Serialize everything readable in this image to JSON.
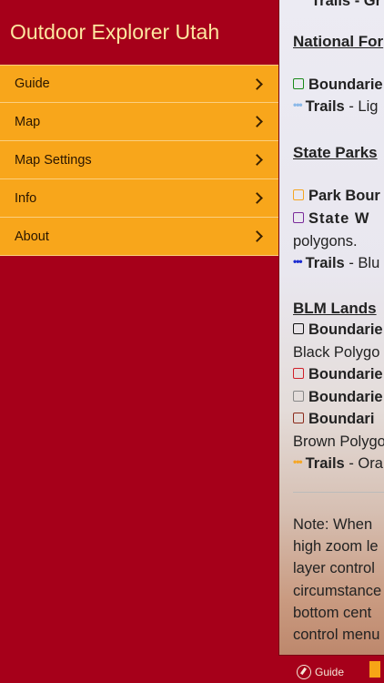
{
  "menu": {
    "title": "Outdoor Explorer Utah",
    "items": [
      {
        "label": "Guide"
      },
      {
        "label": "Map"
      },
      {
        "label": "Map Settings"
      },
      {
        "label": "Info"
      },
      {
        "label": "About"
      }
    ]
  },
  "guide": {
    "top_fragment": "Trails - Gr",
    "national_forest": {
      "heading": "National For",
      "boundaries": "Boundarie",
      "trails": "Trails",
      "trails_desc": "- Lig"
    },
    "state_parks": {
      "heading": "State Parks",
      "park_boundaries": "Park Bour",
      "state_w": "State W",
      "polygons": "polygons.",
      "trails": "Trails",
      "trails_desc": "- Blu"
    },
    "blm_lands": {
      "heading": "BLM Lands",
      "boundaries_black": "Boundarie",
      "black_polygons": "Black Polygo",
      "boundaries_red": "Boundarie",
      "boundaries_gray": "Boundarie",
      "boundaries_brown": "Boundari",
      "brown_polygons": "Brown Polygo",
      "trails": "Trails",
      "trails_desc": "- Ora"
    },
    "note": [
      "Note: When",
      "high zoom le",
      "layer control",
      "circumstance",
      "bottom cent",
      "control menu"
    ],
    "colors": {
      "green": "#1a8a1a",
      "purple": "#7a2a9a",
      "orange": "#f5a623",
      "blue": "#1a2ad0",
      "light_blue": "#8ab8e8",
      "red": "#d0202a",
      "gray": "#888888",
      "brown": "#8b2a1a",
      "black": "#111111"
    }
  },
  "tabbar": {
    "guide_label": "Guide"
  }
}
